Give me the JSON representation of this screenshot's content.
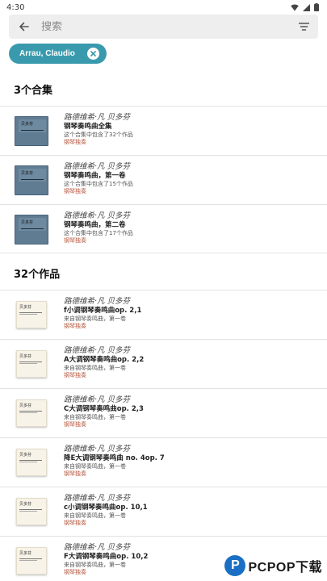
{
  "status_bar": {
    "time": "4:30"
  },
  "search": {
    "placeholder": "搜索"
  },
  "filter_chip": {
    "label": "Arrau, Claudio"
  },
  "collections_section": {
    "title": "3个合集",
    "items": [
      {
        "thumb_label": "贝多芬",
        "composer": "路德维希·凡 贝多芬",
        "title": "钢琴奏鸣曲全集",
        "desc": "这个合集中包含了32个作品",
        "genre": "钢琴独奏"
      },
      {
        "thumb_label": "贝多芬",
        "composer": "路德维希·凡 贝多芬",
        "title": "钢琴奏鸣曲，第一卷",
        "desc": "这个合集中包含了15个作品",
        "genre": "钢琴独奏"
      },
      {
        "thumb_label": "贝多芬",
        "composer": "路德维希·凡 贝多芬",
        "title": "钢琴奏鸣曲，第二卷",
        "desc": "这个合集中包含了17个作品",
        "genre": "钢琴独奏"
      }
    ]
  },
  "works_section": {
    "title": "32个作品",
    "items": [
      {
        "thumb_label": "贝多芬",
        "composer": "路德维希·凡 贝多芬",
        "title": "f小调钢琴奏鸣曲op. 2,1",
        "desc": "来自钢琴奏鸣曲，第一卷",
        "genre": "钢琴独奏"
      },
      {
        "thumb_label": "贝多芬",
        "composer": "路德维希·凡 贝多芬",
        "title": "A大调钢琴奏鸣曲op. 2,2",
        "desc": "来自钢琴奏鸣曲，第一卷",
        "genre": "钢琴独奏"
      },
      {
        "thumb_label": "贝多芬",
        "composer": "路德维希·凡 贝多芬",
        "title": "C大调钢琴奏鸣曲op. 2,3",
        "desc": "来自钢琴奏鸣曲，第一卷",
        "genre": "钢琴独奏"
      },
      {
        "thumb_label": "贝多芬",
        "composer": "路德维希·凡 贝多芬",
        "title": "降E大调钢琴奏鸣曲 no. 4op. 7",
        "desc": "来自钢琴奏鸣曲，第一卷",
        "genre": "钢琴独奏"
      },
      {
        "thumb_label": "贝多芬",
        "composer": "路德维希·凡 贝多芬",
        "title": "c小调钢琴奏鸣曲op. 10,1",
        "desc": "来自钢琴奏鸣曲，第一卷",
        "genre": "钢琴独奏"
      },
      {
        "thumb_label": "贝多芬",
        "composer": "路德维希·凡 贝多芬",
        "title": "F大调钢琴奏鸣曲op. 10,2",
        "desc": "来自钢琴奏鸣曲，第一卷",
        "genre": "钢琴独奏"
      }
    ]
  },
  "watermark": {
    "logo": "P",
    "text": "PCPOP下载"
  },
  "colors": {
    "chip": "#3a9aad",
    "genre": "#b5543a",
    "collection_thumb": "#5f7c93",
    "work_thumb": "#f7f3e8"
  },
  "icons": {
    "back": "arrow-left-icon",
    "filter": "filter-icon",
    "chip_close": "close-icon",
    "wifi": "wifi-icon",
    "signal": "signal-icon",
    "battery": "battery-icon"
  }
}
